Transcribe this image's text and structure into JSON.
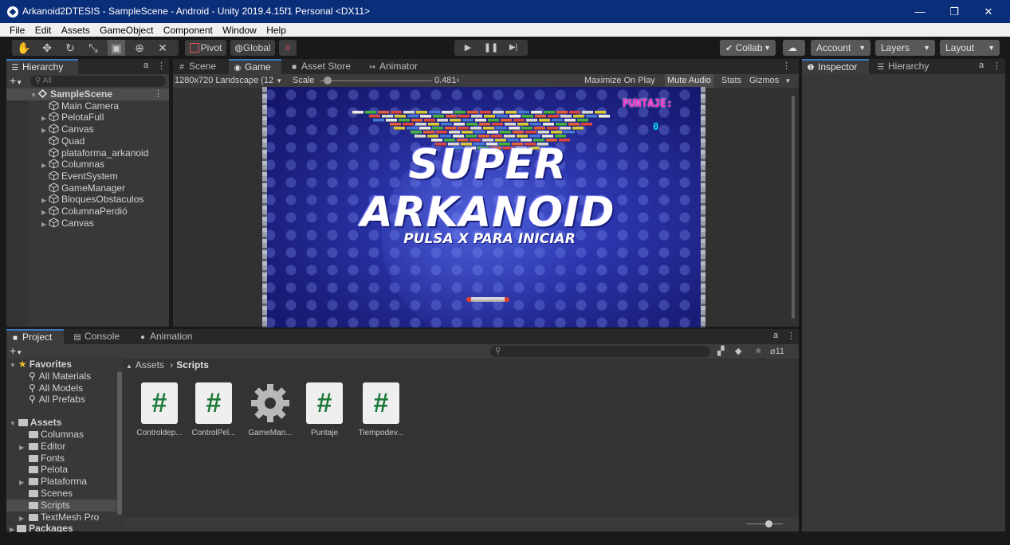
{
  "window": {
    "title": "Arkanoid2DTESIS - SampleScene - Android - Unity 2019.4.15f1 Personal <DX11>",
    "controls": [
      "—",
      "❐",
      "✕"
    ]
  },
  "menu": [
    "File",
    "Edit",
    "Assets",
    "GameObject",
    "Component",
    "Window",
    "Help"
  ],
  "toolbar": {
    "pivot_label": "Pivot",
    "global_label": "Global",
    "collab_label": "Collab",
    "account_label": "Account",
    "layers_label": "Layers",
    "layout_label": "Layout"
  },
  "hierarchy": {
    "tab_label": "Hierarchy",
    "search_placeholder": "All",
    "items": [
      {
        "label": "SampleScene",
        "level": 0,
        "expanded": true,
        "selected": true
      },
      {
        "label": "Main Camera",
        "level": 1,
        "has_children": false
      },
      {
        "label": "PelotaFull",
        "level": 1,
        "has_children": true
      },
      {
        "label": "Canvas",
        "level": 1,
        "has_children": true
      },
      {
        "label": "Quad",
        "level": 1,
        "has_children": false
      },
      {
        "label": "plataforma_arkanoid",
        "level": 1,
        "has_children": false
      },
      {
        "label": "Columnas",
        "level": 1,
        "has_children": true
      },
      {
        "label": "EventSystem",
        "level": 1,
        "has_children": false
      },
      {
        "label": "GameManager",
        "level": 1,
        "has_children": false
      },
      {
        "label": "BloquesObstaculos",
        "level": 1,
        "has_children": true
      },
      {
        "label": "ColumnaPerdió",
        "level": 1,
        "has_children": true
      },
      {
        "label": "Canvas",
        "level": 1,
        "has_children": true
      }
    ]
  },
  "center_tabs": [
    "Scene",
    "Game",
    "Asset Store",
    "Animator"
  ],
  "game_view": {
    "resolution": "1280x720 Landscape (12",
    "scale_label": "Scale",
    "scale_value": "0.481",
    "maximize_label": "Maximize On Play",
    "mute_label": "Mute Audio",
    "stats_label": "Stats",
    "gizmos_label": "Gizmos",
    "game_title": "SUPER ARKANOID",
    "start_prompt": "PULSA X PARA INICIAR",
    "score_label": "PUNTAJE:",
    "score_value": "0"
  },
  "right_tabs": [
    "Inspector",
    "Hierarchy"
  ],
  "bottom_tabs": [
    "Project",
    "Console",
    "Animation"
  ],
  "project": {
    "search_placeholder": "",
    "hidden_count": "11",
    "breadcrumb": [
      "Assets",
      "Scripts"
    ],
    "favorites_label": "Favorites",
    "favorites": [
      "All Materials",
      "All Models",
      "All Prefabs"
    ],
    "assets_label": "Assets",
    "folders": [
      {
        "label": "Columnas",
        "expandable": false
      },
      {
        "label": "Editor",
        "expandable": true
      },
      {
        "label": "Fonts",
        "expandable": false
      },
      {
        "label": "Pelota",
        "expandable": false
      },
      {
        "label": "Plataforma",
        "expandable": true
      },
      {
        "label": "Scenes",
        "expandable": false
      },
      {
        "label": "Scripts",
        "expandable": false,
        "selected": true
      },
      {
        "label": "TextMesh Pro",
        "expandable": true
      }
    ],
    "packages_label": "Packages",
    "files": [
      {
        "label": "Controldep...",
        "icon": "csharp-script-icon"
      },
      {
        "label": "ControlPel...",
        "icon": "csharp-script-icon"
      },
      {
        "label": "GameMan...",
        "icon": "gear-icon"
      },
      {
        "label": "Puntaje",
        "icon": "csharp-script-icon"
      },
      {
        "label": "Tiempodev...",
        "icon": "csharp-script-icon"
      }
    ]
  }
}
